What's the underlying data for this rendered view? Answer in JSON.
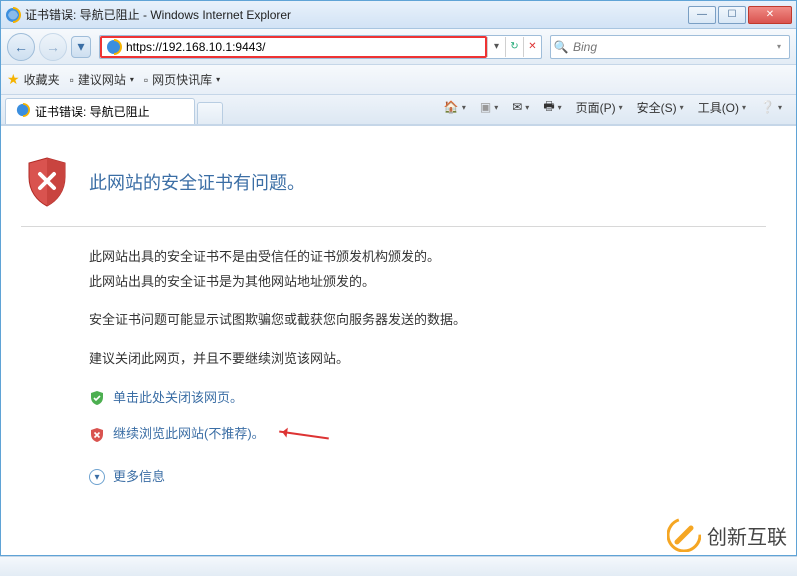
{
  "window": {
    "title": "证书错误: 导航已阻止 - Windows Internet Explorer"
  },
  "nav": {
    "url_display": "https://192.168.10.1:9443/",
    "search_placeholder": "Bing"
  },
  "favbar": {
    "favorites": "收藏夹",
    "suggested": "建议网站",
    "webslice": "网页快讯库"
  },
  "tab": {
    "label": "证书错误: 导航已阻止"
  },
  "toolbar": {
    "page": "页面(P)",
    "safety": "安全(S)",
    "tools": "工具(O)"
  },
  "cert": {
    "heading": "此网站的安全证书有问题。",
    "line1": "此网站出具的安全证书不是由受信任的证书颁发机构颁发的。",
    "line2": "此网站出具的安全证书是为其他网站地址颁发的。",
    "line3": "安全证书问题可能显示试图欺骗您或截获您向服务器发送的数据。",
    "line4": "建议关闭此网页，并且不要继续浏览该网站。",
    "close_link": "单击此处关闭该网页。",
    "continue_link": "继续浏览此网站(不推荐)。",
    "more_info": "更多信息"
  },
  "watermark": {
    "text": "创新互联"
  }
}
